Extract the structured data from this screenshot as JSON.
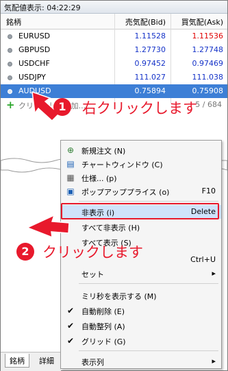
{
  "window": {
    "title": "気配値表示: 04:22:29"
  },
  "columns": {
    "symbol": "銘柄",
    "bid": "売気配(Bid)",
    "ask": "買気配(Ask)"
  },
  "rows": [
    {
      "symbol": "EURUSD",
      "bid": "1.11528",
      "ask": "1.11536",
      "ask_color": "red"
    },
    {
      "symbol": "GBPUSD",
      "bid": "1.27730",
      "ask": "1.27748",
      "ask_color": "blue"
    },
    {
      "symbol": "USDCHF",
      "bid": "0.97452",
      "ask": "0.97469",
      "ask_color": "blue"
    },
    {
      "symbol": "USDJPY",
      "bid": "111.027",
      "ask": "111.038",
      "ask_color": "blue"
    },
    {
      "symbol": "AUDUSD",
      "bid": "0.75894",
      "ask": "0.75908",
      "selected": true
    }
  ],
  "add_row": {
    "label": "クリックして追加...",
    "count": "5 / 684"
  },
  "annotations": {
    "step1_number": "1",
    "step1_text": "右クリックします",
    "step2_number": "2",
    "step2_text": "クリックします"
  },
  "context_menu": {
    "new_order": "新規注文 (N)",
    "chart_window": "チャートウィンドウ (C)",
    "spec": "仕様... (p)",
    "popup_prices": "ポップアッププライス (o)",
    "popup_prices_shortcut": "F10",
    "hide": "非表示 (i)",
    "hide_shortcut": "Delete",
    "hide_all": "すべて非表示 (H)",
    "show_all": "すべて表示 (S)",
    "symbols_shortcut": "Ctrl+U",
    "sets": "セット",
    "show_ms": "ミリ秒を表示する (M)",
    "auto_remove": "自動削除 (E)",
    "auto_arrange": "自動整列 (A)",
    "grid": "グリッド (G)",
    "columns": "表示列"
  },
  "tabs": {
    "symbols": "銘柄",
    "details": "詳細"
  },
  "colors": {
    "accent_red": "#e8192c",
    "selection_blue": "#3d7fd6",
    "bid_blue": "#1432c8"
  }
}
